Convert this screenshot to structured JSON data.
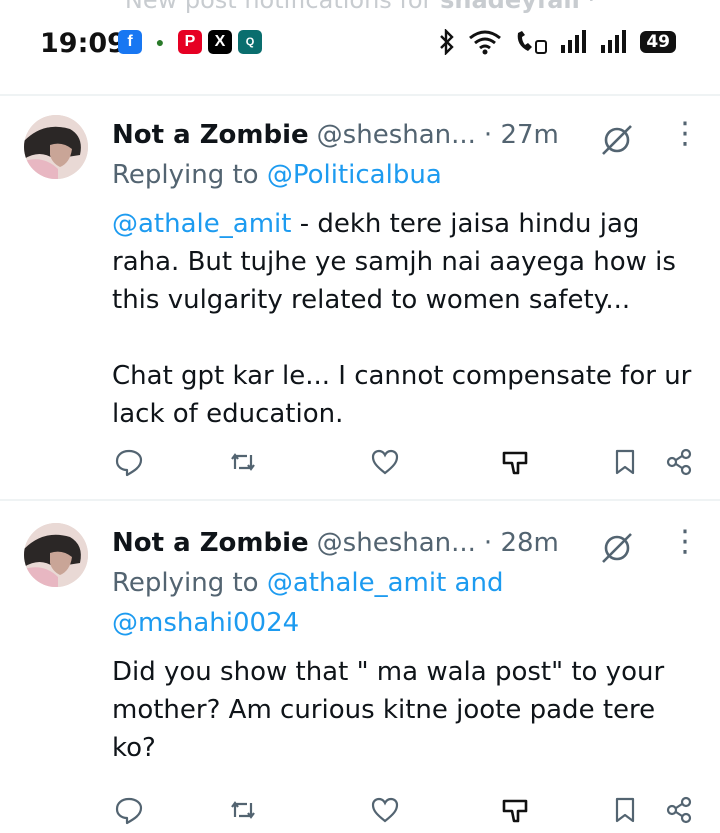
{
  "status_bar": {
    "time": "19:09",
    "notification_banner": "New post notifications for",
    "notification_banner_bold": "shadeyfall",
    "battery": "49",
    "app_icons": [
      {
        "name": "facebook-icon",
        "glyph": "f",
        "color": "#1877f2"
      },
      {
        "name": "app-dots-icon",
        "glyph": "●",
        "color": "#2a7a2a"
      },
      {
        "name": "pinterest-icon",
        "glyph": "P",
        "color": "#e60023"
      },
      {
        "name": "x-icon",
        "glyph": "X",
        "color": "#000000"
      },
      {
        "name": "qubo-icon",
        "glyph": "Q",
        "color": "#0a6e6e"
      }
    ]
  },
  "tweets": [
    {
      "name": "Not a Zombie",
      "handle": "@sheshan...",
      "time": "· 27m",
      "replying_prefix": "Replying to ",
      "replying_to": "@Politicalbua",
      "mention": "@athale_amit",
      "text_after_mention": " - dekh tere jaisa hindu jag raha. But tujhe ye samjh nai aayega how is this vulgarity related to women safety...\n\nChat gpt kar le... I cannot compensate for ur lack of education."
    },
    {
      "name": "Not a Zombie",
      "handle": "@sheshan...",
      "time": "· 28m",
      "replying_prefix": "Replying to ",
      "replying_to": "@athale_amit and @mshahi0024",
      "mention": "",
      "text_after_mention": "Did you show that \" ma wala post\" to your mother? Am curious kitne joote pade tere ko?"
    }
  ],
  "colors": {
    "accent": "#1d9bf0",
    "secondary_text": "#536471",
    "divider": "#eff3f4"
  }
}
